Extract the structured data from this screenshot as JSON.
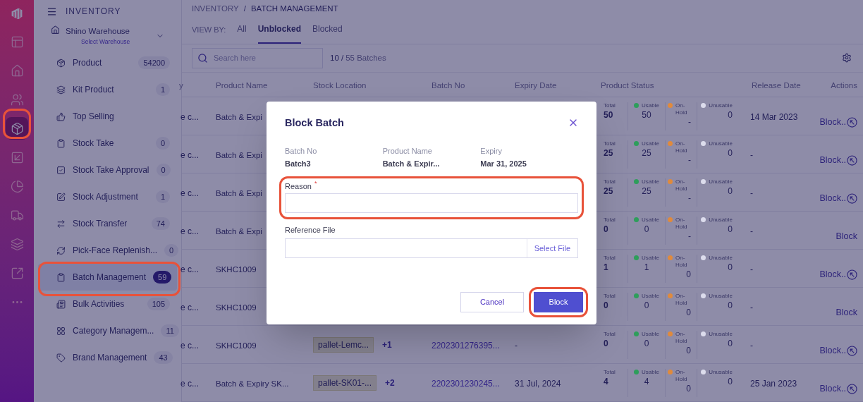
{
  "rail": [
    {
      "selected": false
    },
    {
      "selected": false
    },
    {
      "selected": false
    },
    {
      "selected": true
    },
    {
      "selected": false
    },
    {
      "selected": false
    },
    {
      "selected": false
    },
    {
      "selected": false
    },
    {
      "selected": false
    },
    {
      "selected": false
    }
  ],
  "sidebar": {
    "title": "INVENTORY",
    "warehouse": {
      "name": "Shino Warehouse",
      "hint": "Select Warehouse"
    },
    "items": [
      {
        "label": "Product",
        "badge": "54200",
        "selected": false
      },
      {
        "label": "Kit Product",
        "badge": "1",
        "selected": false
      },
      {
        "label": "Top Selling",
        "selected": false
      },
      {
        "label": "Stock Take",
        "badge": "0",
        "selected": false
      },
      {
        "label": "Stock Take Approval",
        "badge": "0",
        "selected": false
      },
      {
        "label": "Stock Adjustment",
        "badge": "1",
        "selected": false
      },
      {
        "label": "Stock Transfer",
        "badge": "74",
        "selected": false
      },
      {
        "label": "Pick-Face Replenish...",
        "badge": "0",
        "selected": false
      },
      {
        "label": "Batch Management",
        "badge": "59",
        "selected": true
      },
      {
        "label": "Bulk Activities",
        "badge": "105",
        "selected": false
      },
      {
        "label": "Category Managem...",
        "badge": "11",
        "selected": false
      },
      {
        "label": "Brand Management",
        "badge": "43",
        "selected": false
      }
    ]
  },
  "breadcrumb": {
    "parent": "INVENTORY",
    "separator": "/",
    "current": "BATCH MANAGEMENT"
  },
  "view_by": {
    "label": "VIEW BY:",
    "tabs": [
      {
        "label": "All",
        "selected": false
      },
      {
        "label": "Unblocked",
        "selected": true
      },
      {
        "label": "Blocked",
        "selected": false
      }
    ]
  },
  "search": {
    "placeholder": "Search here"
  },
  "batch_count": {
    "shown": "10 /",
    "total": "55 Batches"
  },
  "table": {
    "columns": [
      "y",
      "Product Name",
      "Stock Location",
      "Batch No",
      "Expiry Date",
      "Product Status",
      "Release Date",
      "Actions"
    ],
    "rows": [
      {
        "column_1": "e c...",
        "product_name": "Batch & Expi",
        "status": [
          {
            "kind": "total",
            "label": "Total",
            "value": "50"
          },
          {
            "kind": "usable",
            "label": "Usable",
            "value": "50",
            "color": "#2e9e5b"
          },
          {
            "kind": "on_hold",
            "label": "On-Hold",
            "value": "-",
            "color": "#e08a3c"
          },
          {
            "kind": "unusable",
            "label": "Unusable",
            "value": "0",
            "color": "#dcdcec"
          }
        ],
        "release_date": "14 Mar 2023",
        "action": {
          "label": "Block..",
          "has_icon": true
        }
      },
      {
        "column_1": "e c...",
        "product_name": "Batch & Expi",
        "status": [
          {
            "kind": "total",
            "label": "Total",
            "value": "25"
          },
          {
            "kind": "usable",
            "label": "Usable",
            "value": "25",
            "color": "#2e9e5b"
          },
          {
            "kind": "on_hold",
            "label": "On-Hold",
            "value": "-",
            "color": "#e08a3c"
          },
          {
            "kind": "unusable",
            "label": "Unusable",
            "value": "0",
            "color": "#dcdcec"
          }
        ],
        "release_date": "-",
        "action": {
          "label": "Block..",
          "has_icon": true
        }
      },
      {
        "column_1": "e c...",
        "product_name": "Batch & Expi",
        "status": [
          {
            "kind": "total",
            "label": "Total",
            "value": "25"
          },
          {
            "kind": "usable",
            "label": "Usable",
            "value": "25",
            "color": "#2e9e5b"
          },
          {
            "kind": "on_hold",
            "label": "On-Hold",
            "value": "-",
            "color": "#e08a3c"
          },
          {
            "kind": "unusable",
            "label": "Unusable",
            "value": "0",
            "color": "#dcdcec"
          }
        ],
        "release_date": "-",
        "action": {
          "label": "Block..",
          "has_icon": true
        }
      },
      {
        "column_1": "e c...",
        "product_name": "Batch & Expi",
        "status": [
          {
            "kind": "total",
            "label": "Total",
            "value": "0"
          },
          {
            "kind": "usable",
            "label": "Usable",
            "value": "0",
            "color": "#2e9e5b"
          },
          {
            "kind": "on_hold",
            "label": "On-Hold",
            "value": "-",
            "color": "#e08a3c"
          },
          {
            "kind": "unusable",
            "label": "Unusable",
            "value": "0",
            "color": "#dcdcec"
          }
        ],
        "release_date": "-",
        "action": {
          "label": "Block",
          "has_icon": false
        }
      },
      {
        "column_1": "e c...",
        "product_name": "SKHC1009",
        "status": [
          {
            "kind": "total",
            "label": "Total",
            "value": "1"
          },
          {
            "kind": "usable",
            "label": "Usable",
            "value": "1",
            "color": "#2e9e5b"
          },
          {
            "kind": "on_hold",
            "label": "On-Hold",
            "value": "0",
            "color": "#e08a3c"
          },
          {
            "kind": "unusable",
            "label": "Unusable",
            "value": "0",
            "color": "#dcdcec"
          }
        ],
        "release_date": "-",
        "action": {
          "label": "Block..",
          "has_icon": true
        }
      },
      {
        "column_1": "e c...",
        "product_name": "SKHC1009",
        "status": [
          {
            "kind": "total",
            "label": "Total",
            "value": "0"
          },
          {
            "kind": "usable",
            "label": "Usable",
            "value": "0",
            "color": "#2e9e5b"
          },
          {
            "kind": "on_hold",
            "label": "On-Hold",
            "value": "0",
            "color": "#e08a3c"
          },
          {
            "kind": "unusable",
            "label": "Unusable",
            "value": "0",
            "color": "#dcdcec"
          }
        ],
        "release_date": "-",
        "action": {
          "label": "Block",
          "has_icon": false
        }
      },
      {
        "column_1": "e c...",
        "product_name": "SKHC1009",
        "stock_location": {
          "tag": "pallet-Lemc...",
          "more": "+1"
        },
        "batch_no": "2202301276395...",
        "expiry_date": "-",
        "status": [
          {
            "kind": "total",
            "label": "Total",
            "value": "0"
          },
          {
            "kind": "usable",
            "label": "Usable",
            "value": "0",
            "color": "#2e9e5b"
          },
          {
            "kind": "on_hold",
            "label": "On-Hold",
            "value": "0",
            "color": "#e08a3c"
          },
          {
            "kind": "unusable",
            "label": "Unusable",
            "value": "0",
            "color": "#dcdcec"
          }
        ],
        "release_date": "-",
        "action": {
          "label": "Block..",
          "has_icon": true
        }
      },
      {
        "column_1": "e c...",
        "product_name": "Batch & Expiry SK...",
        "stock_location": {
          "tag": "pallet-SK01-...",
          "more": "+2"
        },
        "batch_no": "2202301230245...",
        "expiry_date": "31 Jul, 2024",
        "status": [
          {
            "kind": "total",
            "label": "Total",
            "value": "4"
          },
          {
            "kind": "usable",
            "label": "Usable",
            "value": "4",
            "color": "#2e9e5b"
          },
          {
            "kind": "on_hold",
            "label": "On-Hold",
            "value": "0",
            "color": "#e08a3c"
          },
          {
            "kind": "unusable",
            "label": "Unusable",
            "value": "0",
            "color": "#dcdcec"
          }
        ],
        "release_date": "25 Jan 2023",
        "action": {
          "label": "Block..",
          "has_icon": true
        }
      }
    ]
  },
  "modal": {
    "title": "Block Batch",
    "details": [
      {
        "label": "Batch No",
        "value": "Batch3"
      },
      {
        "label": "Product Name",
        "value": "Batch & Expir..."
      },
      {
        "label": "Expiry",
        "value": "Mar 31, 2025"
      }
    ],
    "reason": {
      "label": "Reason",
      "required_mark": "*"
    },
    "reference_file": {
      "label": "Reference File",
      "button": "Select File"
    },
    "buttons": [
      {
        "kind": "secondary",
        "label": "Cancel"
      },
      {
        "kind": "primary",
        "label": "Block"
      }
    ]
  }
}
